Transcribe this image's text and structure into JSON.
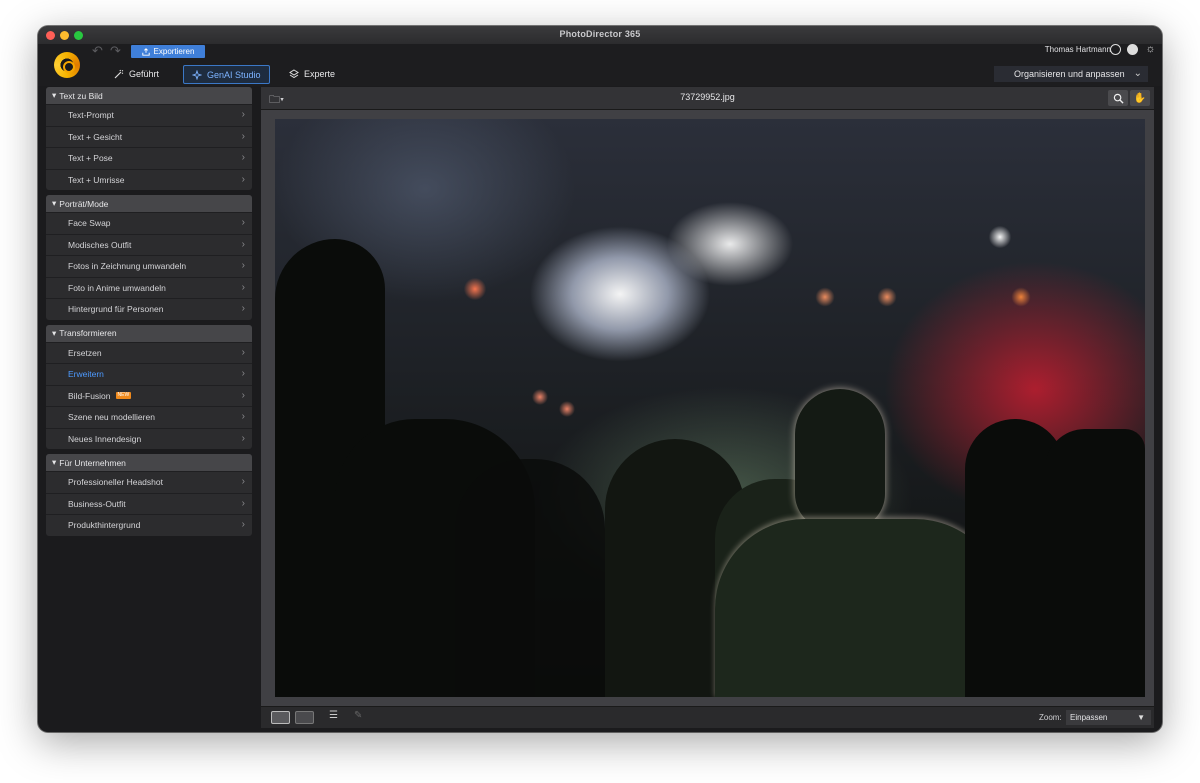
{
  "window": {
    "title": "PhotoDirector 365"
  },
  "toolbar": {
    "export_label": "Exportieren"
  },
  "mode_tabs": [
    {
      "label": "Geführt",
      "icon": "wand-icon",
      "active": false
    },
    {
      "label": "GenAI Studio",
      "icon": "sparkle-icon",
      "active": true
    },
    {
      "label": "Experte",
      "icon": "layers-icon",
      "active": false
    }
  ],
  "user": {
    "name": "Thomas Hartmann"
  },
  "workspace_dropdown": {
    "label": "Organisieren und anpassen"
  },
  "sidebar": {
    "sections": [
      {
        "title": "Text zu Bild",
        "items": [
          {
            "label": "Text-Prompt"
          },
          {
            "label": "Text + Gesicht"
          },
          {
            "label": "Text + Pose"
          },
          {
            "label": "Text + Umrisse"
          }
        ]
      },
      {
        "title": "Porträt/Mode",
        "items": [
          {
            "label": "Face Swap"
          },
          {
            "label": "Modisches Outfit"
          },
          {
            "label": "Fotos in Zeichnung umwandeln"
          },
          {
            "label": "Foto in Anime umwandeln"
          },
          {
            "label": "Hintergrund für Personen"
          }
        ]
      },
      {
        "title": "Transformieren",
        "items": [
          {
            "label": "Ersetzen"
          },
          {
            "label": "Erweitern",
            "selected": true
          },
          {
            "label": "Bild-Fusion",
            "badge": "NEW"
          },
          {
            "label": "Szene neu modellieren"
          },
          {
            "label": "Neues Innendesign"
          }
        ]
      },
      {
        "title": "Für Unternehmen",
        "items": [
          {
            "label": "Professioneller Headshot"
          },
          {
            "label": "Business-Outfit"
          },
          {
            "label": "Produkthintergrund"
          }
        ]
      }
    ]
  },
  "viewer": {
    "filename": "73729952.jpg",
    "zoom_label": "Zoom:",
    "zoom_value": "Einpassen"
  },
  "colors": {
    "accent": "#3f7fd9",
    "selected_text": "#4d9aff",
    "badge": "#f08a1c"
  }
}
